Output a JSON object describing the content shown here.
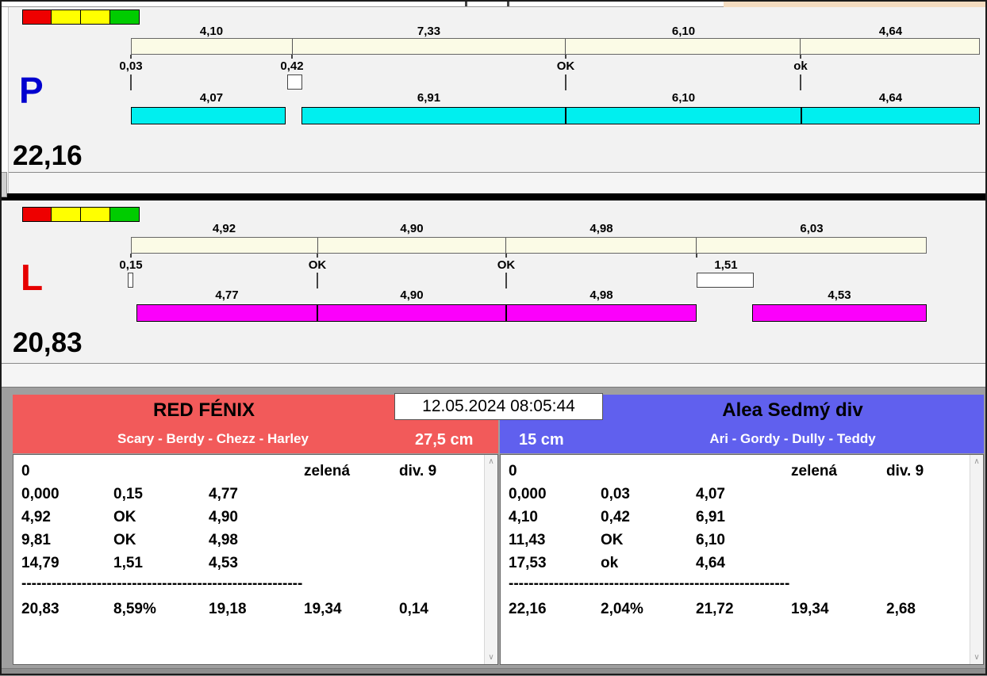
{
  "icons": {
    "scroll_up": "∧",
    "scroll_down": "∨"
  },
  "colors": {
    "p_run_bar": "#00efef",
    "l_run_bar": "#fb00fb",
    "plan_bar": "#fbfbe6",
    "team_left_bg": "#f25a5a",
    "team_right_bg": "#6060ee",
    "status_lights": [
      "#ee0000",
      "#ffff00",
      "#ffff00",
      "#00cc00"
    ]
  },
  "panel_p": {
    "letter": "P",
    "total": "22,16",
    "top_labels": [
      "4,10",
      "7,33",
      "6,10",
      "4,64"
    ],
    "markers": [
      "0,03",
      "0,42",
      "OK",
      "ok"
    ],
    "bottom_labels": [
      "4,07",
      "6,91",
      "6,10",
      "4,64"
    ]
  },
  "panel_l": {
    "letter": "L",
    "total": "20,83",
    "top_labels": [
      "4,92",
      "4,90",
      "4,98",
      "6,03"
    ],
    "markers": [
      "0,15",
      "OK",
      "OK",
      "1,51"
    ],
    "bottom_labels": [
      "4,77",
      "4,90",
      "4,98",
      "4,53"
    ]
  },
  "datetime": "12.05.2024 08:05:44",
  "team_left": {
    "name": "RED FÉNIX",
    "members": "Scary - Berdy - Chezz - Harley",
    "height": "27,5 cm",
    "result_header": [
      "0",
      "zelená",
      "div. 9"
    ],
    "rows": [
      [
        "0,000",
        "0,15",
        "4,77"
      ],
      [
        "4,92",
        "OK",
        "4,90"
      ],
      [
        "9,81",
        "OK",
        "4,98"
      ],
      [
        "14,79",
        "1,51",
        "4,53"
      ]
    ],
    "separator": "--------------------------------------------------------",
    "totals": [
      "20,83",
      "8,59%",
      "19,18",
      "19,34",
      "0,14"
    ]
  },
  "team_right": {
    "name": "Alea Sedmý div",
    "members": "Ari - Gordy - Dully - Teddy",
    "height": "15 cm",
    "result_header": [
      "0",
      "zelená",
      "div. 9"
    ],
    "rows": [
      [
        "0,000",
        "0,03",
        "4,07"
      ],
      [
        "4,10",
        "0,42",
        "6,91"
      ],
      [
        "11,43",
        "OK",
        "6,10"
      ],
      [
        "17,53",
        "ok",
        "4,64"
      ]
    ],
    "separator": "--------------------------------------------------------",
    "totals": [
      "22,16",
      "2,04%",
      "21,72",
      "19,34",
      "2,68"
    ]
  }
}
